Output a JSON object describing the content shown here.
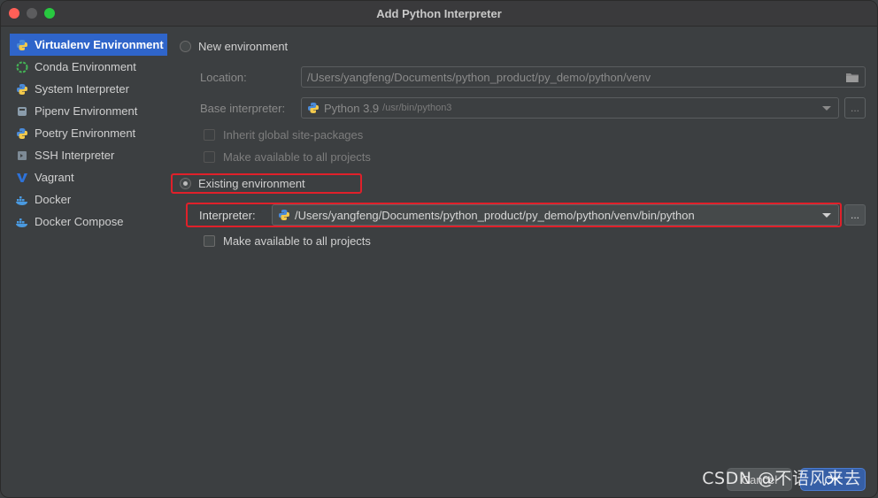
{
  "window": {
    "title": "Add Python Interpreter"
  },
  "sidebar": {
    "items": [
      {
        "label": "Virtualenv Environment",
        "icon": "python-icon",
        "selected": true
      },
      {
        "label": "Conda Environment",
        "icon": "conda-icon"
      },
      {
        "label": "System Interpreter",
        "icon": "python-icon"
      },
      {
        "label": "Pipenv Environment",
        "icon": "pipenv-icon"
      },
      {
        "label": "Poetry Environment",
        "icon": "python-icon"
      },
      {
        "label": "SSH Interpreter",
        "icon": "terminal-icon"
      },
      {
        "label": "Vagrant",
        "icon": "vagrant-icon"
      },
      {
        "label": "Docker",
        "icon": "docker-icon"
      },
      {
        "label": "Docker Compose",
        "icon": "docker-icon"
      }
    ]
  },
  "new_env": {
    "radio_label": "New environment",
    "location_label": "Location:",
    "location_value": "/Users/yangfeng/Documents/python_product/py_demo/python/venv",
    "base_label": "Base interpreter:",
    "base_value": "Python 3.9",
    "base_path": "/usr/bin/python3",
    "inherit_label": "Inherit global site-packages",
    "make_available_label": "Make available to all projects"
  },
  "existing_env": {
    "radio_label": "Existing environment",
    "interpreter_label": "Interpreter:",
    "interpreter_value": "/Users/yangfeng/Documents/python_product/py_demo/python/venv/bin/python",
    "make_available_label": "Make available to all projects"
  },
  "buttons": {
    "browse": "...",
    "cancel": "Cancel",
    "ok": "OK"
  },
  "watermark": "CSDN @不语风来去",
  "colors": {
    "selected": "#2f65ca",
    "highlight": "#e0202a",
    "ok": "#365fa6"
  }
}
